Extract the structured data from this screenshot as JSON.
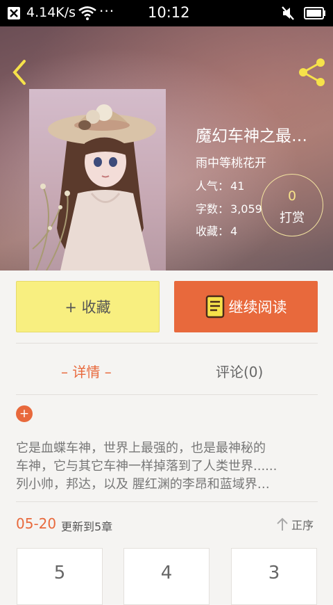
{
  "status_bar": {
    "speed": "4.14K/s",
    "dots": "···",
    "time": "10:12"
  },
  "book": {
    "title": "魔幻车神之最…",
    "author": "雨中等桃花开",
    "popularity_label": "人气：",
    "popularity_value": "41",
    "wordcount_label": "字数：",
    "wordcount_value": "3,059",
    "favorites_label": "收藏：",
    "favorites_value": "4",
    "synopsis_lines": [
      "它是血蝶车神，世界上最强的，也是最神秘的",
      "车神，它与其它车神一样掉落到了人类世界......",
      "列小帅，邦达，以及 腥红渊的李昂和蓝域界…"
    ]
  },
  "reward": {
    "count": "0",
    "label": "打赏"
  },
  "actions": {
    "collect_label": "+ 收藏",
    "read_label": "继续阅读"
  },
  "tabs": {
    "detail": "– 详情 –",
    "comments": "评论(0)"
  },
  "expand": {
    "symbol": "+"
  },
  "updates": {
    "date": "05-20",
    "info": "更新到5章",
    "sort_label": "正序"
  },
  "chapters": [
    "5",
    "4",
    "3"
  ],
  "colors": {
    "accent": "#e8693c",
    "collect_bg": "#f8ef80",
    "icon_yellow": "#f6e24a"
  },
  "icons": {
    "back": "chevron-left-icon",
    "share": "share-icon",
    "book": "book-icon",
    "sort": "arrow-up-icon"
  }
}
